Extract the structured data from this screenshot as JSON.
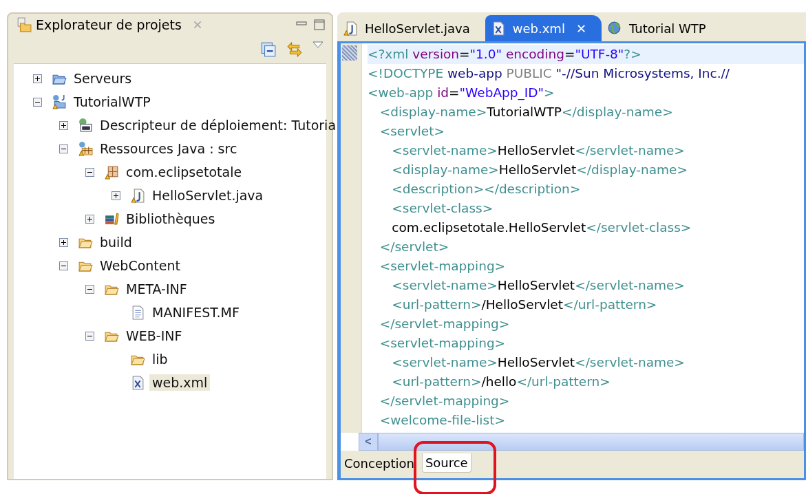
{
  "explorer": {
    "title": "Explorateur de projets",
    "tree": [
      {
        "label": "Serveurs",
        "kind": "folder-blue",
        "expanded": false,
        "selected": false
      },
      {
        "label": "TutorialWTP",
        "kind": "project",
        "expanded": true,
        "selected": false,
        "children": [
          {
            "label": "Descripteur de déploiement: Tutoria",
            "kind": "descriptor",
            "expanded": false,
            "selected": false
          },
          {
            "label": "Ressources Java : src",
            "kind": "source",
            "expanded": true,
            "selected": false,
            "children": [
              {
                "label": "com.eclipsetotale",
                "kind": "package",
                "expanded": true,
                "selected": false,
                "children": [
                  {
                    "label": "HelloServlet.java",
                    "kind": "java",
                    "expanded": false,
                    "selected": false
                  }
                ]
              },
              {
                "label": "Bibliothèques",
                "kind": "library",
                "expanded": false,
                "selected": false
              }
            ]
          },
          {
            "label": "build",
            "kind": "folder",
            "expanded": false,
            "selected": false
          },
          {
            "label": "WebContent",
            "kind": "folder",
            "expanded": true,
            "selected": false,
            "children": [
              {
                "label": "META-INF",
                "kind": "folder",
                "expanded": true,
                "selected": false,
                "children": [
                  {
                    "label": "MANIFEST.MF",
                    "kind": "file",
                    "selected": false
                  }
                ]
              },
              {
                "label": "WEB-INF",
                "kind": "folder",
                "expanded": true,
                "selected": false,
                "children": [
                  {
                    "label": "lib",
                    "kind": "folder",
                    "selected": false
                  },
                  {
                    "label": "web.xml",
                    "kind": "xml",
                    "selected": true
                  }
                ]
              }
            ]
          }
        ]
      }
    ]
  },
  "editor": {
    "tabs": [
      {
        "label": "HelloServlet.java",
        "kind": "java",
        "selected": false
      },
      {
        "label": "web.xml",
        "kind": "xml",
        "selected": true,
        "close": "✕"
      },
      {
        "label": "Tutorial WTP",
        "kind": "globe",
        "selected": false
      }
    ],
    "lines": [
      [
        {
          "kind": "tag",
          "text": "<?xml "
        },
        {
          "kind": "attr",
          "text": "version"
        },
        {
          "kind": "text",
          "text": "="
        },
        {
          "kind": "value",
          "text": "\"1.0\" "
        },
        {
          "kind": "attr",
          "text": "encoding"
        },
        {
          "kind": "text",
          "text": "="
        },
        {
          "kind": "value",
          "text": "\"UTF-8\""
        },
        {
          "kind": "tag",
          "text": "?>"
        }
      ],
      [
        {
          "kind": "tag",
          "text": "<!DOCTYPE "
        },
        {
          "kind": "dtname",
          "text": "web-app "
        },
        {
          "kind": "keyword",
          "text": "PUBLIC "
        },
        {
          "kind": "dtname",
          "text": "\"-//Sun Microsystems, Inc.//"
        }
      ],
      [
        {
          "kind": "tag",
          "text": "<web-app "
        },
        {
          "kind": "attr",
          "text": "id"
        },
        {
          "kind": "text",
          "text": "="
        },
        {
          "kind": "value",
          "text": "\"WebApp_ID\""
        },
        {
          "kind": "tag",
          "text": ">"
        }
      ],
      [
        {
          "kind": "tag",
          "text": "   <display-name>"
        },
        {
          "kind": "text",
          "text": "TutorialWTP"
        },
        {
          "kind": "tag",
          "text": "</display-name>"
        }
      ],
      [
        {
          "kind": "tag",
          "text": "   <servlet>"
        }
      ],
      [
        {
          "kind": "tag",
          "text": "      <servlet-name>"
        },
        {
          "kind": "text",
          "text": "HelloServlet"
        },
        {
          "kind": "tag",
          "text": "</servlet-name>"
        }
      ],
      [
        {
          "kind": "tag",
          "text": "      <display-name>"
        },
        {
          "kind": "text",
          "text": "HelloServlet"
        },
        {
          "kind": "tag",
          "text": "</display-name>"
        }
      ],
      [
        {
          "kind": "tag",
          "text": "      <description></description>"
        }
      ],
      [
        {
          "kind": "tag",
          "text": "      <servlet-class>"
        }
      ],
      [
        {
          "kind": "text",
          "text": "      com.eclipsetotale.HelloServlet"
        },
        {
          "kind": "tag",
          "text": "</servlet-class>"
        }
      ],
      [
        {
          "kind": "tag",
          "text": "   </servlet>"
        }
      ],
      [
        {
          "kind": "tag",
          "text": "   <servlet-mapping>"
        }
      ],
      [
        {
          "kind": "tag",
          "text": "      <servlet-name>"
        },
        {
          "kind": "text",
          "text": "HelloServlet"
        },
        {
          "kind": "tag",
          "text": "</servlet-name>"
        }
      ],
      [
        {
          "kind": "tag",
          "text": "      <url-pattern>"
        },
        {
          "kind": "text",
          "text": "/HelloServlet"
        },
        {
          "kind": "tag",
          "text": "</url-pattern>"
        }
      ],
      [
        {
          "kind": "tag",
          "text": "   </servlet-mapping>"
        }
      ],
      [
        {
          "kind": "tag",
          "text": "   <servlet-mapping>"
        }
      ],
      [
        {
          "kind": "tag",
          "text": "      <servlet-name>"
        },
        {
          "kind": "text",
          "text": "HelloServlet"
        },
        {
          "kind": "tag",
          "text": "</servlet-name>"
        }
      ],
      [
        {
          "kind": "tag",
          "text": "      <url-pattern>"
        },
        {
          "kind": "text",
          "text": "/hello"
        },
        {
          "kind": "tag",
          "text": "</url-pattern>"
        }
      ],
      [
        {
          "kind": "tag",
          "text": "   </servlet-mapping>"
        }
      ],
      [
        {
          "kind": "tag",
          "text": "   <welcome-file-list>"
        }
      ]
    ],
    "scroll_left": "<",
    "bottom_tabs": [
      {
        "label": "Conception",
        "selected": false,
        "highlighted": false
      },
      {
        "label": "Source",
        "selected": true,
        "highlighted": true
      }
    ]
  }
}
